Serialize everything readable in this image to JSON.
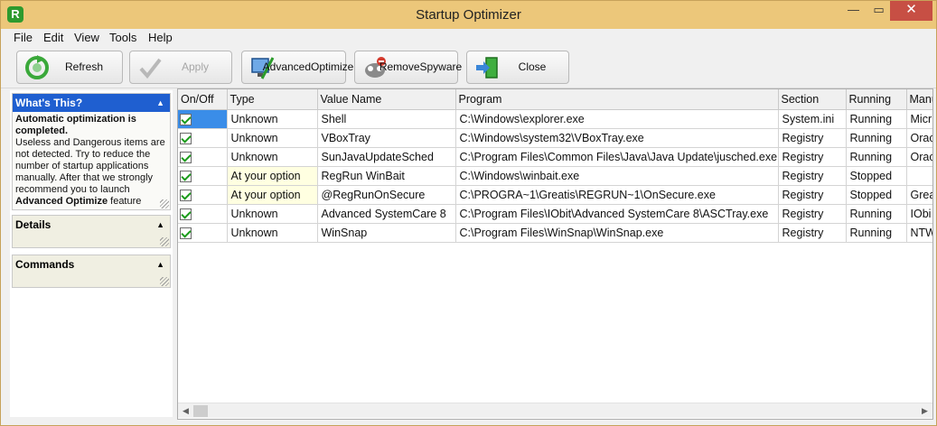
{
  "window": {
    "title": "Startup Optimizer",
    "app_icon_letter": "R",
    "minimize": "—",
    "maximize": "▭",
    "close": "✕"
  },
  "menu": [
    "File",
    "Edit",
    "View",
    "Tools",
    "Help"
  ],
  "toolbar": {
    "refresh": "Refresh",
    "apply": "Apply",
    "advanced_line1": "Advanced",
    "advanced_line2": "Optimize",
    "spyware_line1": "Remove",
    "spyware_line2": "Spyware",
    "close": "Close"
  },
  "panels": {
    "whats_this": {
      "title": "What's This?",
      "bold_intro": "Automatic optimization is completed.",
      "text": "Useless and Dangerous items are not detected. Try to reduce the number of startup applications manually. After that we strongly recommend you to launch",
      "bold_tail": "Advanced Optimize",
      "tail": "feature"
    },
    "details": {
      "title": "Details"
    },
    "commands": {
      "title": "Commands"
    }
  },
  "table": {
    "columns": [
      "On/Off",
      "Type",
      "Value Name",
      "Program",
      "Section",
      "Running",
      "Manu"
    ],
    "rows": [
      {
        "type": "Unknown",
        "value_name": "Shell",
        "program": "C:\\Windows\\explorer.exe",
        "section": "System.ini",
        "running": "Running",
        "manu": "Micr"
      },
      {
        "type": "Unknown",
        "value_name": "VBoxTray",
        "program": "C:\\Windows\\system32\\VBoxTray.exe",
        "section": "Registry",
        "running": "Running",
        "manu": "Orac"
      },
      {
        "type": "Unknown",
        "value_name": "SunJavaUpdateSched",
        "program": "C:\\Program Files\\Common Files\\Java\\Java Update\\jusched.exe",
        "section": "Registry",
        "running": "Running",
        "manu": "Orac"
      },
      {
        "type": "At your option",
        "value_name": "RegRun WinBait",
        "program": "C:\\Windows\\winbait.exe",
        "section": "Registry",
        "running": "Stopped",
        "manu": ""
      },
      {
        "type": "At your option",
        "value_name": "@RegRunOnSecure",
        "program": "C:\\PROGRA~1\\Greatis\\REGRUN~1\\OnSecure.exe",
        "section": "Registry",
        "running": "Stopped",
        "manu": "Grea"
      },
      {
        "type": "Unknown",
        "value_name": "Advanced SystemCare 8",
        "program": "C:\\Program Files\\IObit\\Advanced SystemCare 8\\ASCTray.exe",
        "section": "Registry",
        "running": "Running",
        "manu": "IObi"
      },
      {
        "type": "Unknown",
        "value_name": "WinSnap",
        "program": "C:\\Program Files\\WinSnap\\WinSnap.exe",
        "section": "Registry",
        "running": "Running",
        "manu": "NTW"
      }
    ]
  },
  "colors": {
    "titlebar": "#ecc77a",
    "selection": "#3a8de8",
    "option_highlight": "#ffffe1",
    "panel_header": "#1f5fd0"
  }
}
